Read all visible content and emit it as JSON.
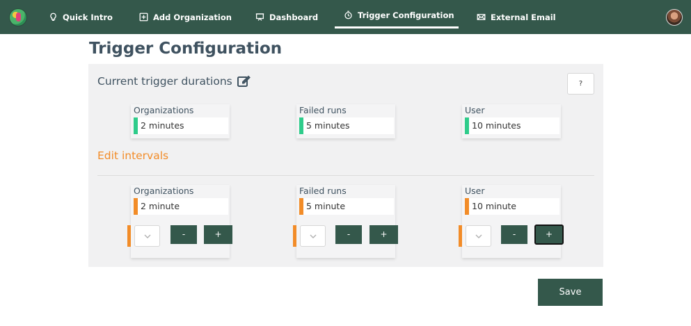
{
  "nav": {
    "items": [
      {
        "label": "Quick Intro",
        "icon": "lightbulb-icon"
      },
      {
        "label": "Add Organization",
        "icon": "plus-square-icon"
      },
      {
        "label": "Dashboard",
        "icon": "presentation-icon"
      },
      {
        "label": "Trigger Configuration",
        "icon": "timer-icon",
        "active": true
      },
      {
        "label": "External Email",
        "icon": "envelope-icon"
      }
    ]
  },
  "page": {
    "title": "Trigger Configuration"
  },
  "current": {
    "heading": "Current trigger durations",
    "help_label": "?",
    "cards": [
      {
        "label": "Organizations",
        "value": "2 minutes"
      },
      {
        "label": "Failed runs",
        "value": "5 minutes"
      },
      {
        "label": "User",
        "value": "10 minutes"
      }
    ]
  },
  "edit": {
    "heading": "Edit intervals",
    "cards": [
      {
        "label": "Organizations",
        "value": "2 minute",
        "minus": "-",
        "plus": "+"
      },
      {
        "label": "Failed runs",
        "value": "5 minute",
        "minus": "-",
        "plus": "+"
      },
      {
        "label": "User",
        "value": "10 minute",
        "minus": "-",
        "plus": "+"
      }
    ]
  },
  "actions": {
    "save_label": "Save"
  },
  "colors": {
    "brand": "#34584b",
    "accent_orange": "#f28c28",
    "accent_green": "#2fcc8b",
    "title": "#3f5260"
  }
}
